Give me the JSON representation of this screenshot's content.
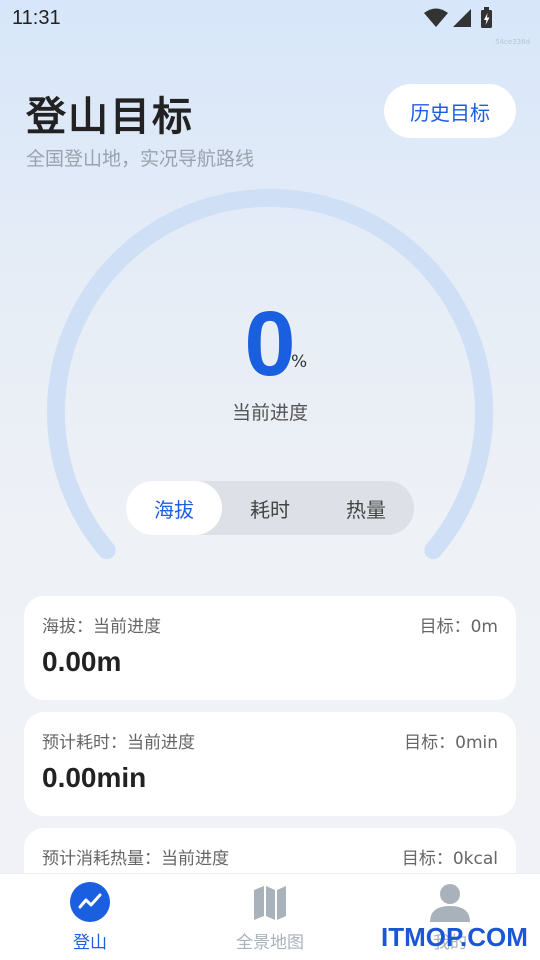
{
  "status_bar": {
    "time": "11:31",
    "tiny_text": "54ce336d"
  },
  "header": {
    "title": "登山目标",
    "subtitle": "全国登山地，实况导航路线",
    "history_button": "历史目标"
  },
  "progress": {
    "value": "0",
    "unit": "%",
    "label": "当前进度",
    "fraction": 0
  },
  "segment": {
    "tabs": [
      "海拔",
      "耗时",
      "热量"
    ],
    "active_index": 0
  },
  "cards": [
    {
      "label": "海拔：当前进度",
      "target": "目标：0m",
      "value": "0.00m"
    },
    {
      "label": "预计耗时：当前进度",
      "target": "目标：0min",
      "value": "0.00min"
    },
    {
      "label": "预计消耗热量：当前进度",
      "target": "目标：0kcal",
      "value": ""
    }
  ],
  "bottom_nav": [
    {
      "label": "登山",
      "icon": "trend-chart-icon",
      "active": true
    },
    {
      "label": "全景地图",
      "icon": "map-icon",
      "active": false
    },
    {
      "label": "我的",
      "icon": "user-icon",
      "active": false
    }
  ],
  "watermark": "ITMOP.COM",
  "colors": {
    "accent": "#1a5fe0",
    "gauge_track": "#cfdff5",
    "inactive": "#a9b1bb",
    "watermark": "#1a56d6"
  }
}
